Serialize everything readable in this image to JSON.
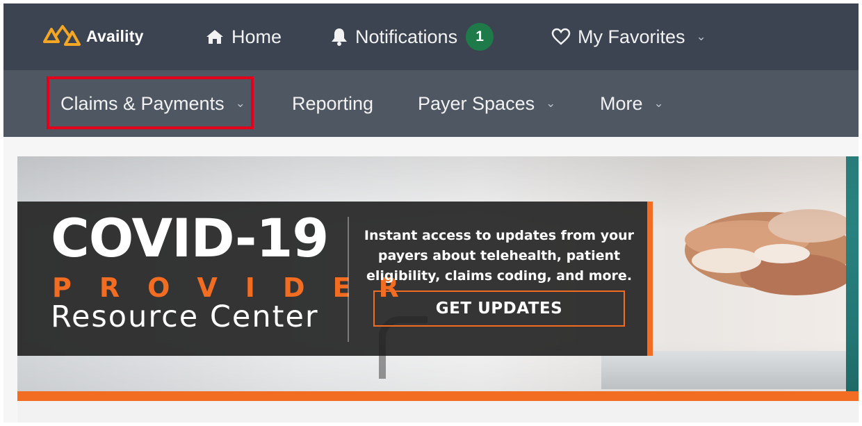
{
  "header": {
    "brand": "Availity",
    "nav": [
      {
        "label": "Home",
        "icon": "home-icon"
      },
      {
        "label": "Notifications",
        "icon": "bell-icon",
        "badge": "1"
      },
      {
        "label": "My Favorites",
        "icon": "heart-icon",
        "has_dropdown": true
      }
    ]
  },
  "subnav": {
    "items": [
      {
        "label": "Claims & Payments",
        "has_dropdown": true,
        "highlighted": true
      },
      {
        "label": "Reporting",
        "has_dropdown": false
      },
      {
        "label": "Payer Spaces",
        "has_dropdown": true
      },
      {
        "label": "More",
        "has_dropdown": true
      }
    ]
  },
  "banner": {
    "headline": "COVID-19",
    "subheadline": "PROVIDER",
    "tagline": "Resource Center",
    "description": "Instant access to updates from your payers about telehealth, patient eligibility, claims coding, and more.",
    "cta_label": "GET UPDATES"
  },
  "colors": {
    "topbar": "#3b4450",
    "subbar": "#4e5762",
    "accent_orange": "#f26c21",
    "badge_green": "#1f7a4a",
    "highlight_red": "#e4001b"
  }
}
